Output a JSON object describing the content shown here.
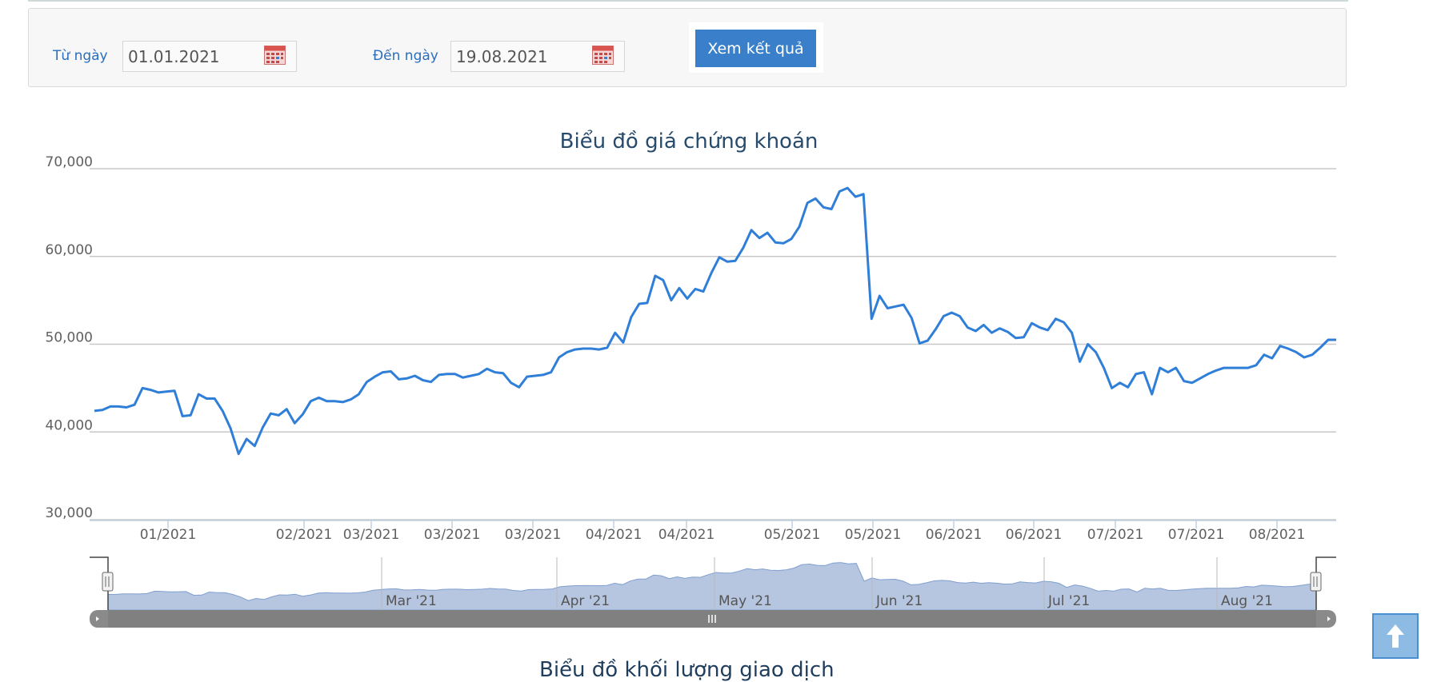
{
  "filter": {
    "from_label": "Từ ngày",
    "from_value": "01.01.2021",
    "to_label": "Đến ngày",
    "to_value": "19.08.2021",
    "submit_label": "Xem kết quả"
  },
  "colors": {
    "accent": "#3a7fc9",
    "line": "#2f7ed8",
    "navigator_fill": "#b7c6e0",
    "grid": "#c8c8c8",
    "title": "#274b6d"
  },
  "icons": {
    "calendar": "calendar-icon",
    "scroll_top": "arrow-up-icon"
  },
  "chart_data": {
    "type": "line",
    "title": "Biểu đồ giá chứng khoán",
    "ylim": [
      30000,
      70000
    ],
    "yticks": [
      "70,000",
      "60,000",
      "50,000",
      "40,000",
      "30,000"
    ],
    "ytick_values": [
      70000,
      60000,
      50000,
      40000,
      30000
    ],
    "grid": true,
    "xtick_labels": [
      "01/2021",
      "02/2021",
      "03/2021",
      "03/2021",
      "03/2021",
      "04/2021",
      "04/2021",
      "05/2021",
      "05/2021",
      "06/2021",
      "06/2021",
      "07/2021",
      "07/2021",
      "08/2021"
    ],
    "series": [
      {
        "values": [
          42400,
          42500,
          42900,
          42900,
          42800,
          43100,
          45000,
          44800,
          44500,
          44600,
          44700,
          41800,
          41900,
          44300,
          43800,
          43800,
          42400,
          40400,
          37500,
          39200,
          38400,
          40500,
          42100,
          41900,
          42600,
          41000,
          42000,
          43500,
          43900,
          43500,
          43500,
          43400,
          43700,
          44300,
          45700,
          46300,
          46800,
          46900,
          46000,
          46100,
          46400,
          45900,
          45700,
          46500,
          46600,
          46600,
          46200,
          46400,
          46600,
          47200,
          46800,
          46700,
          45600,
          45100,
          46300,
          46400,
          46500,
          46800,
          48500,
          49100,
          49400,
          49500,
          49500,
          49400,
          49600,
          51300,
          50200,
          53100,
          54600,
          54700,
          57800,
          57300,
          55000,
          56400,
          55200,
          56300,
          56000,
          58100,
          59900,
          59400,
          59500,
          61000,
          63000,
          62100,
          62700,
          61600,
          61500,
          62000,
          63400,
          66100,
          66600,
          65600,
          65400,
          67400,
          67800,
          66800,
          67100,
          52900,
          55500,
          54100,
          54300,
          54500,
          53000,
          50100,
          50400,
          51700,
          53200,
          53600,
          53200,
          51900,
          51500,
          52200,
          51300,
          51800,
          51400,
          50700,
          50800,
          52400,
          51900,
          51600,
          52900,
          52500,
          51300,
          48000,
          50000,
          49100,
          47300,
          45000,
          45600,
          45100,
          46600,
          46800,
          44300,
          47300,
          46800,
          47300,
          45800,
          45600,
          46100,
          46600,
          47000,
          47300,
          47300,
          47300,
          47300,
          47600,
          48800,
          48400,
          49800,
          49500,
          49100,
          48500,
          48800,
          49600,
          50500,
          50500
        ]
      }
    ],
    "navigator": {
      "labels": [
        "Mar '21",
        "Apr '21",
        "May '21",
        "Jun '21",
        "Jul '21",
        "Aug '21"
      ]
    }
  },
  "footer": {
    "next_chart_title_partial": "Biểu đồ khối lượng giao dịch"
  }
}
